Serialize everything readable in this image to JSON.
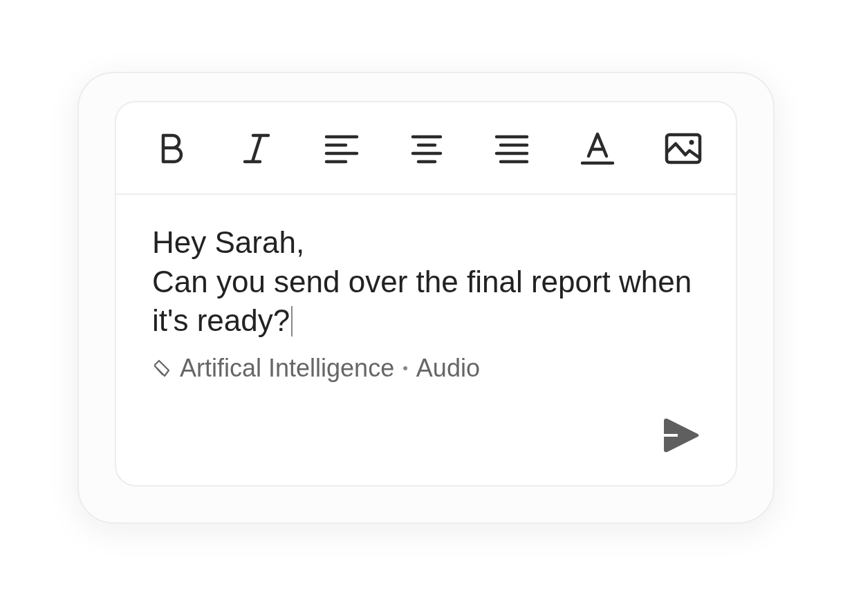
{
  "toolbar": [
    {
      "kind": "bold"
    },
    {
      "kind": "italic"
    },
    {
      "kind": "align-left"
    },
    {
      "kind": "align-center"
    },
    {
      "kind": "align-right"
    },
    {
      "kind": "text-color"
    },
    {
      "kind": "image"
    }
  ],
  "message": {
    "greeting": "Hey Sarah,",
    "body": "Can you send over the final report when it's ready?",
    "cursor": true
  },
  "tags": [
    "Artifical Intelligence",
    "Audio"
  ],
  "separator": "•"
}
